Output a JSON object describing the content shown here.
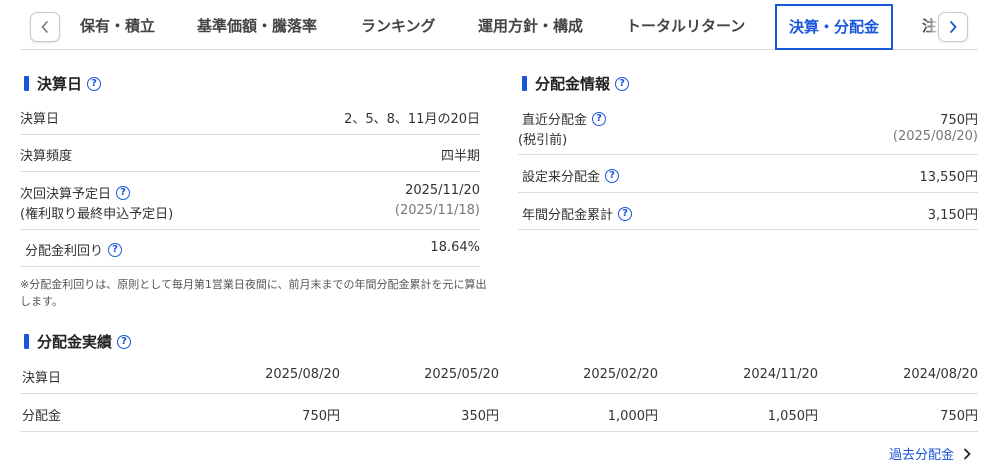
{
  "tabs": {
    "items": [
      {
        "label": "保有・積立"
      },
      {
        "label": "基準価額・騰落率"
      },
      {
        "label": "ランキング"
      },
      {
        "label": "運用方針・構成"
      },
      {
        "label": "トータルリターン"
      },
      {
        "label": "決算・分配金",
        "active": true
      },
      {
        "label": "注"
      }
    ],
    "prev_icon": "chevron-left-icon",
    "next_icon": "chevron-right-icon"
  },
  "settlement": {
    "title": "決算日",
    "rows": [
      {
        "label": "決算日",
        "value": "2、5、8、11月の20日"
      },
      {
        "label": "決算頻度",
        "value": "四半期"
      },
      {
        "label": "次回決算予定日",
        "label_sub": "(権利取り最終申込予定日)",
        "value": "2025/11/20",
        "value_sub": "(2025/11/18)"
      },
      {
        "label": "分配金利回り",
        "value": "18.64%"
      }
    ],
    "note": "※分配金利回りは、原則として毎月第1営業日夜間に、前月末までの年間分配金累計を元に算出します。"
  },
  "distribution_info": {
    "title": "分配金情報",
    "rows": [
      {
        "label": "直近分配金",
        "label_sub": "(税引前)",
        "value": "750円",
        "value_sub": "(2025/08/20)"
      },
      {
        "label": "設定来分配金",
        "value": "13,550円"
      },
      {
        "label": "年間分配金累計",
        "value": "3,150円"
      }
    ]
  },
  "history": {
    "title": "分配金実績",
    "header_label": "決算日",
    "row_label": "分配金",
    "dates": [
      "2025/08/20",
      "2025/05/20",
      "2025/02/20",
      "2024/11/20",
      "2024/08/20"
    ],
    "amounts": [
      "750円",
      "350円",
      "1,000円",
      "1,050円",
      "750円"
    ],
    "more_link": "過去分配金"
  },
  "colors": {
    "accent": "#1a56db",
    "divider": "#dcdcdc"
  }
}
